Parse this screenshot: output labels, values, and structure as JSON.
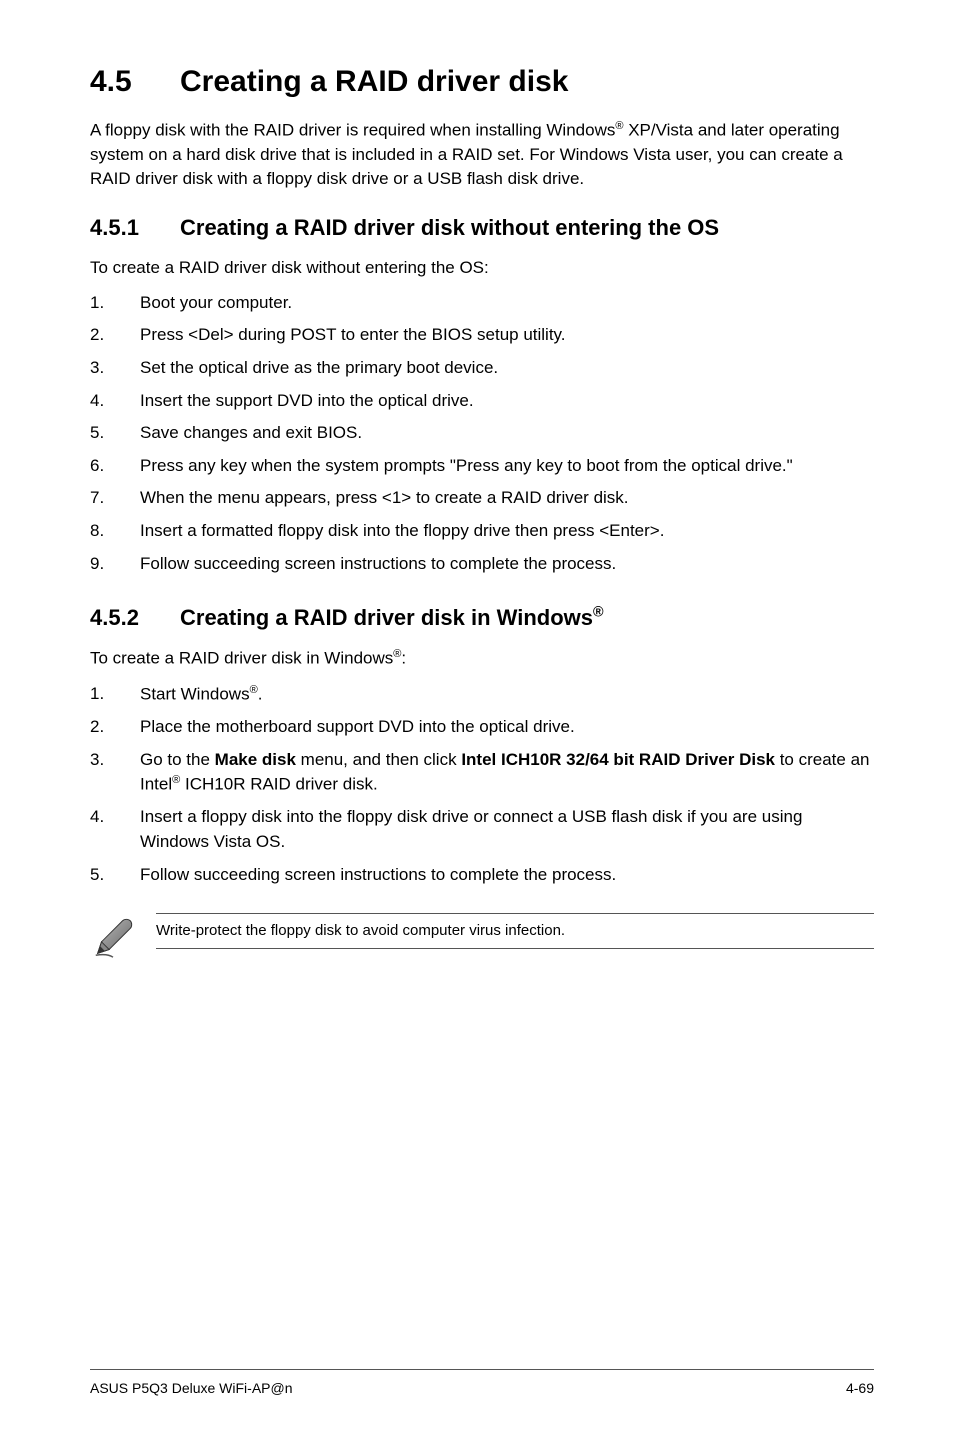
{
  "title": {
    "num": "4.5",
    "text": "Creating a RAID driver disk"
  },
  "intro_html": "A floppy disk with the RAID driver is required when installing Windows<sup>®</sup> XP/Vista and later operating system on a hard disk drive that is included in a RAID set. For Windows Vista user, you can create a RAID driver disk with a floppy disk drive or a USB flash disk drive.",
  "s1": {
    "num": "4.5.1",
    "heading": "Creating a RAID driver disk without entering the OS",
    "lead": "To create a RAID driver disk without entering the OS:",
    "steps": [
      "Boot your computer.",
      "Press <Del> during POST to enter the BIOS setup utility.",
      "Set the optical drive as the primary boot device.",
      "Insert the support DVD into the optical drive.",
      "Save changes and exit BIOS.",
      "Press any key when the system prompts \"Press any key to boot from the optical drive.\"",
      "When the menu appears, press <1> to create a RAID driver disk.",
      "Insert a formatted floppy disk into the floppy drive then press <Enter>.",
      "Follow succeeding screen instructions to complete the process."
    ]
  },
  "s2": {
    "num": "4.5.2",
    "heading_html": "Creating a RAID driver disk in Windows<sup>®</sup>",
    "lead_html": "To create a RAID driver disk in Windows<sup>®</sup>:",
    "steps_html": [
      "Start Windows<sup>®</sup>.",
      "Place the motherboard support DVD into the optical drive.",
      "Go to the <b>Make disk</b> menu, and then click <b>Intel ICH10R 32/64 bit RAID Driver Disk</b> to create an Intel<sup>®</sup> ICH10R RAID driver disk.",
      "Insert a floppy disk into the floppy disk drive or connect a USB flash disk if you are using Windows Vista OS.",
      "Follow succeeding screen instructions to complete the process."
    ]
  },
  "note": "Write-protect the floppy disk to avoid computer virus infection.",
  "footer": {
    "left": "ASUS P5Q3 Deluxe WiFi-AP@n",
    "right": "4-69"
  }
}
